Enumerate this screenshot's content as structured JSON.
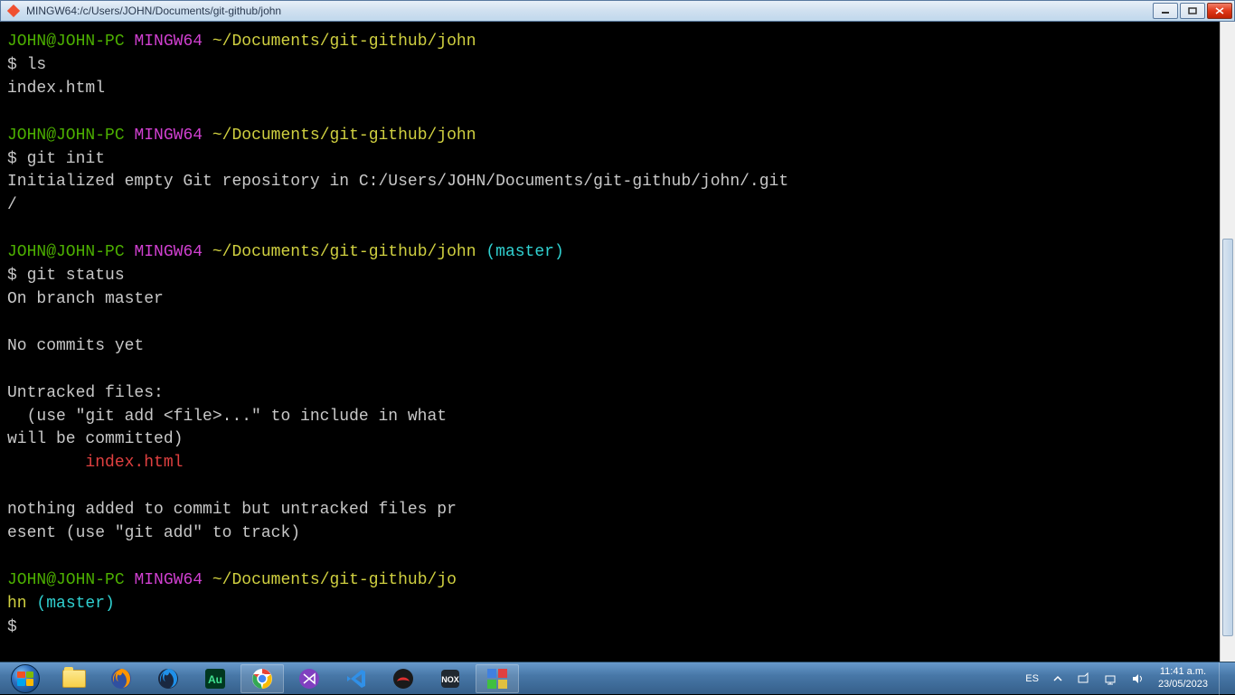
{
  "window": {
    "title": "MINGW64:/c/Users/JOHN/Documents/git-github/john"
  },
  "terminal": {
    "prompts": [
      {
        "user_host": "JOHN@JOHN-PC",
        "env": "MINGW64",
        "path": "~/Documents/git-github/john",
        "branch": ""
      },
      {
        "user_host": "JOHN@JOHN-PC",
        "env": "MINGW64",
        "path": "~/Documents/git-github/john",
        "branch": ""
      },
      {
        "user_host": "JOHN@JOHN-PC",
        "env": "MINGW64",
        "path": "~/Documents/git-github/john",
        "branch": "(master)"
      },
      {
        "user_host": "JOHN@JOHN-PC",
        "env": "MINGW64",
        "path_part1": "~/Documents/git-github/jo",
        "path_part2": "hn",
        "branch": "(master)"
      }
    ],
    "commands": {
      "c1": "$ ls",
      "c2": "$ git init",
      "c3": "$ git status",
      "c4": "$"
    },
    "outputs": {
      "ls": "index.html",
      "init1": "Initialized empty Git repository in C:/Users/JOHN/Documents/git-github/john/.git",
      "init2": "/",
      "status_branch": "On branch master",
      "status_commits": "No commits yet",
      "status_untracked_header": "Untracked files:",
      "status_untracked_hint1": "  (use \"git add <file>...\" to include in what",
      "status_untracked_hint2": "will be committed)",
      "status_untracked_file": "        index.html",
      "status_footer1": "nothing added to commit but untracked files pr",
      "status_footer2": "esent (use \"git add\" to track)"
    }
  },
  "taskbar": {
    "lang": "ES",
    "time": "11:41 a.m.",
    "date": "23/05/2023"
  }
}
